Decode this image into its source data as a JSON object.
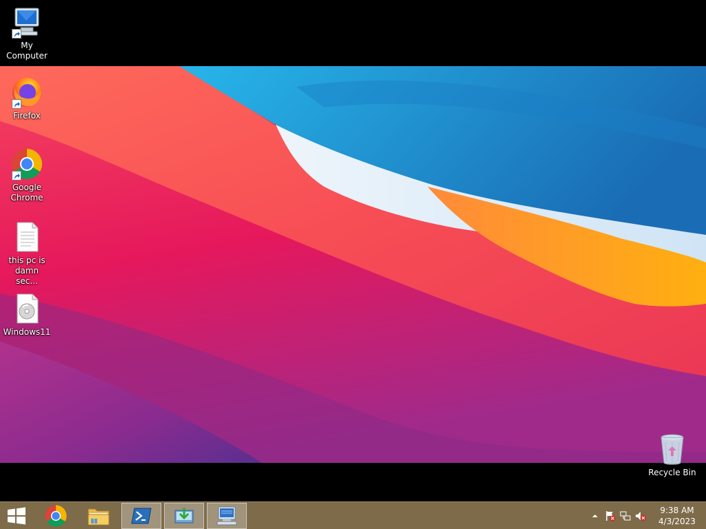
{
  "desktop": {
    "icons": [
      {
        "label": "My Computer",
        "icon": "computer-icon"
      },
      {
        "label": "Firefox",
        "icon": "firefox-icon"
      },
      {
        "label": "Google Chrome",
        "icon": "chrome-icon"
      },
      {
        "label": "this pc is damn sec...",
        "icon": "text-file-icon"
      },
      {
        "label": "Windows11",
        "icon": "disc-image-icon"
      },
      {
        "label": "Recycle Bin",
        "icon": "recycle-bin-icon"
      }
    ]
  },
  "taskbar": {
    "start": {
      "icon": "windows-logo-icon"
    },
    "pinned": [
      {
        "name": "Google Chrome",
        "icon": "chrome-icon"
      },
      {
        "name": "File Explorer",
        "icon": "folder-icon"
      },
      {
        "name": "PowerShell",
        "icon": "powershell-icon",
        "active": true
      },
      {
        "name": "Installer",
        "icon": "download-installer-icon",
        "active": true
      },
      {
        "name": "Remote Desktop",
        "icon": "remote-desktop-icon",
        "active": true
      }
    ],
    "tray": {
      "icons": [
        "show-hidden-icons-chevron-icon",
        "action-center-flag-icon",
        "network-icon",
        "volume-muted-icon"
      ],
      "time": "9:38 AM",
      "date": "4/3/2023"
    }
  },
  "colors": {
    "taskbar": "#7d6b4a",
    "letterbox": "#000000"
  }
}
